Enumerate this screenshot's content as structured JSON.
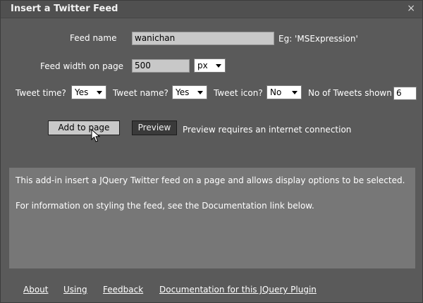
{
  "window": {
    "title": "Insert a Twitter Feed",
    "close_glyph": "×"
  },
  "form": {
    "feed_name_label": "Feed name",
    "feed_name_value": "wanichan",
    "feed_name_hint": "Eg: 'MSExpression'",
    "feed_width_label": "Feed width on page",
    "feed_width_value": "500",
    "unit_value": "px",
    "tweet_time_label": "Tweet time?",
    "tweet_time_value": "Yes",
    "tweet_name_label": "Tweet name?",
    "tweet_name_value": "Yes",
    "tweet_icon_label": "Tweet icon?",
    "tweet_icon_value": "No",
    "tweet_count_label": "No of Tweets shown",
    "tweet_count_value": "6"
  },
  "actions": {
    "add_label": "Add to page",
    "preview_label": "Preview",
    "preview_note": "Preview requires an internet connection"
  },
  "info": {
    "line1": "This add-in insert a JQuery Twitter feed on a page and allows display options to be selected.",
    "line2": "For information on styling the feed, see the Documentation link below."
  },
  "footer": {
    "about": "About",
    "using": "Using",
    "feedback": "Feedback",
    "documentation": "Documentation for this JQuery Plugin"
  },
  "colors": {
    "background": "#5a5a5a",
    "info_panel": "#777777",
    "input_fill": "#c8c8c8"
  }
}
